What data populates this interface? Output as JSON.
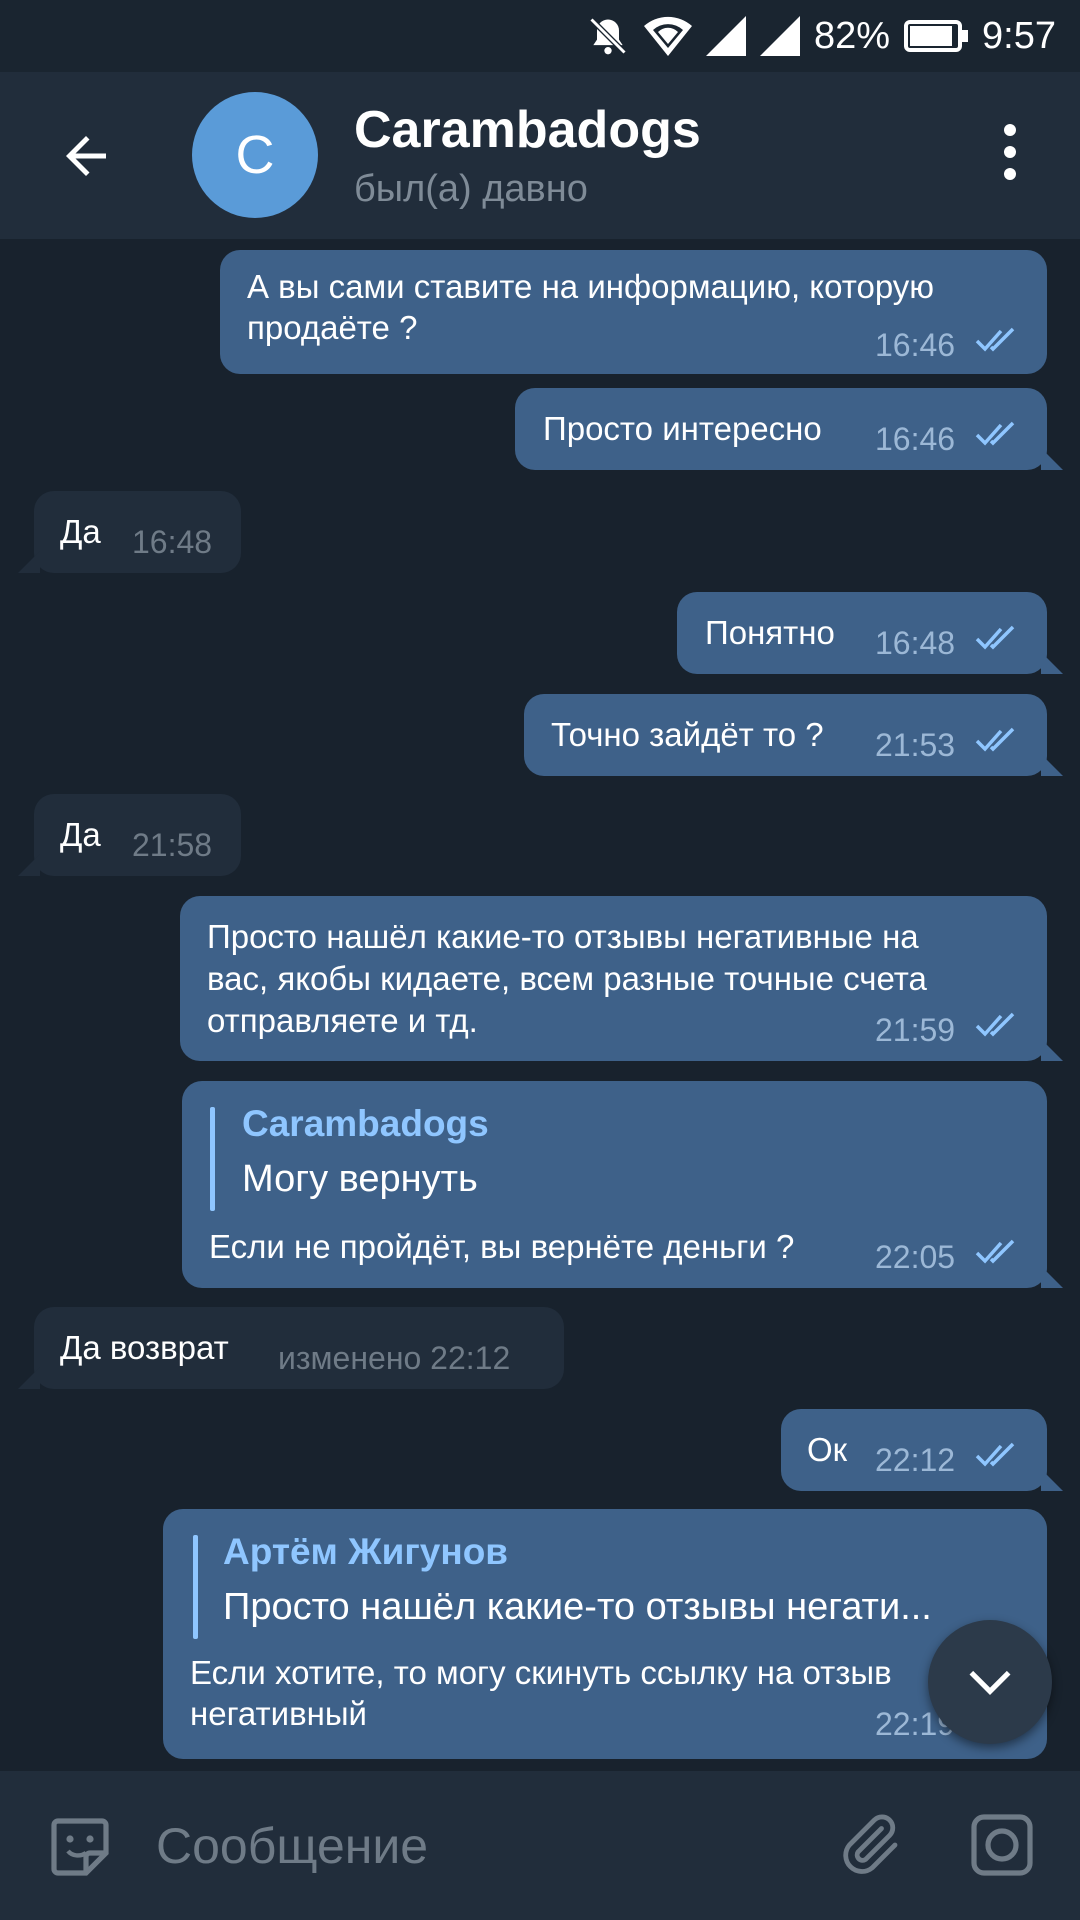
{
  "status_bar": {
    "battery": "82%",
    "time": "9:57"
  },
  "header": {
    "avatar_letter": "C",
    "title": "Carambadogs",
    "subtitle": "был(а) давно"
  },
  "messages": [
    {
      "dir": "out",
      "lines": [
        "А вы сами ставите на информацию, которую",
        "продаёте ?"
      ],
      "time": "16:46"
    },
    {
      "dir": "out",
      "lines": [
        "Просто интересно"
      ],
      "time": "16:46"
    },
    {
      "dir": "in",
      "lines": [
        "Да"
      ],
      "time": "16:48"
    },
    {
      "dir": "out",
      "lines": [
        "Понятно"
      ],
      "time": "16:48"
    },
    {
      "dir": "out",
      "lines": [
        "Точно зайдёт то ?"
      ],
      "time": "21:53"
    },
    {
      "dir": "in",
      "lines": [
        "Да"
      ],
      "time": "21:58"
    },
    {
      "dir": "out",
      "lines": [
        "Просто нашёл какие-то отзывы негативные на",
        "вас, якобы кидаете, всем разные точные счета",
        "отправляете и тд."
      ],
      "time": "21:59"
    },
    {
      "dir": "out",
      "reply_name": "Carambadogs",
      "reply_text": "Могу вернуть",
      "lines": [
        "Если не пройдёт, вы вернёте деньги ?"
      ],
      "time": "22:05"
    },
    {
      "dir": "in",
      "lines": [
        "Да возврат"
      ],
      "time": "изменено 22:12"
    },
    {
      "dir": "out",
      "lines": [
        "Ок"
      ],
      "time": "22:12"
    },
    {
      "dir": "out",
      "reply_name": "Артём Жигунов",
      "reply_text": "Просто нашёл какие-то отзывы негати...",
      "lines": [
        "Если хотите, то могу скинуть ссылку на отзыв",
        "негативный"
      ],
      "time": "22:19"
    }
  ],
  "input": {
    "placeholder": "Сообщение"
  },
  "colors": {
    "bg": "#18222d",
    "bar": "#212d3b",
    "out_bubble": "#3e6189",
    "in_bubble": "#212d3b",
    "accent": "#8fc6ff"
  },
  "icons": [
    "mute-bell-icon",
    "wifi-icon",
    "signal-icon",
    "battery-icon",
    "back-arrow-icon",
    "more-vert-icon",
    "double-check-icon",
    "chevron-down-icon",
    "sticker-icon",
    "paperclip-icon",
    "camera-icon"
  ]
}
